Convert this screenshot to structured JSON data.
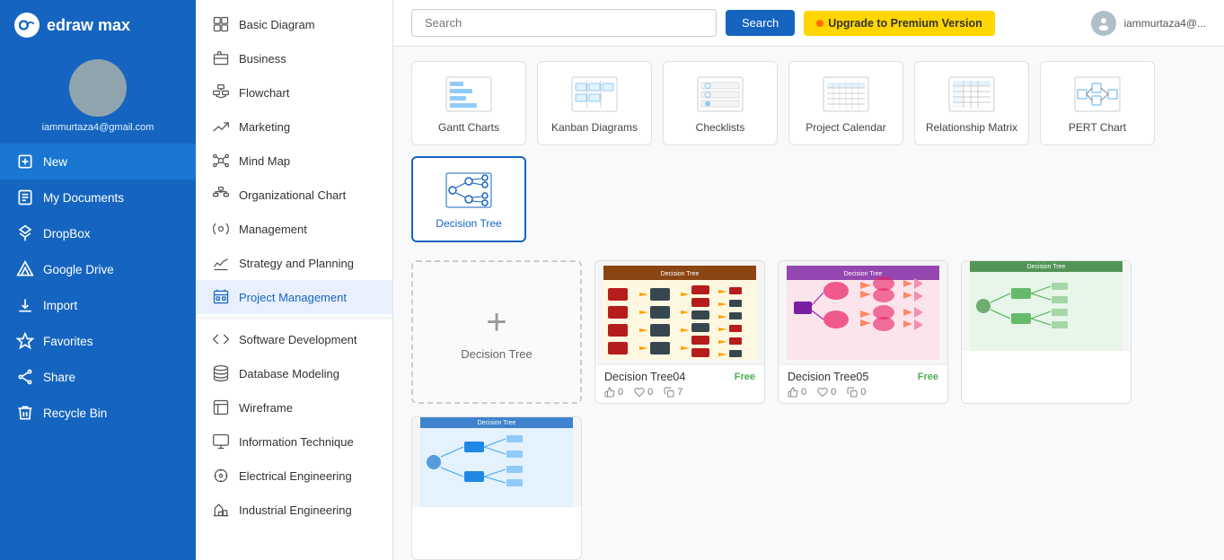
{
  "app": {
    "name": "edraw max",
    "logo_symbol": "D"
  },
  "user": {
    "email": "iammurtaza4@gmail.com",
    "email_short": "iammurtaza4@..."
  },
  "topbar": {
    "search_placeholder": "Search",
    "search_btn": "Search",
    "upgrade_btn": "Upgrade to Premium Version",
    "upgrade_dot_color": "#ff6d00"
  },
  "left_nav": [
    {
      "id": "new",
      "label": "New",
      "active": true
    },
    {
      "id": "my-documents",
      "label": "My Documents",
      "active": false
    },
    {
      "id": "dropbox",
      "label": "DropBox",
      "active": false
    },
    {
      "id": "google-drive",
      "label": "Google Drive",
      "active": false
    },
    {
      "id": "import",
      "label": "Import",
      "active": false
    },
    {
      "id": "favorites",
      "label": "Favorites",
      "active": false
    },
    {
      "id": "share",
      "label": "Share",
      "active": false
    },
    {
      "id": "recycle-bin",
      "label": "Recycle Bin",
      "active": false
    }
  ],
  "mid_nav": [
    {
      "id": "basic-diagram",
      "label": "Basic Diagram",
      "active": false
    },
    {
      "id": "business",
      "label": "Business",
      "active": false
    },
    {
      "id": "flowchart",
      "label": "Flowchart",
      "active": false
    },
    {
      "id": "marketing",
      "label": "Marketing",
      "active": false
    },
    {
      "id": "mind-map",
      "label": "Mind Map",
      "active": false
    },
    {
      "id": "organizational-chart",
      "label": "Organizational Chart",
      "active": false
    },
    {
      "id": "management",
      "label": "Management",
      "active": false
    },
    {
      "id": "strategy-and-planning",
      "label": "Strategy and Planning",
      "active": false
    },
    {
      "id": "project-management",
      "label": "Project Management",
      "active": true
    },
    {
      "id": "software-development",
      "label": "Software Development",
      "active": false
    },
    {
      "id": "database-modeling",
      "label": "Database Modeling",
      "active": false
    },
    {
      "id": "wireframe",
      "label": "Wireframe",
      "active": false
    },
    {
      "id": "information-technique",
      "label": "Information Technique",
      "active": false
    },
    {
      "id": "electrical-engineering",
      "label": "Electrical Engineering",
      "active": false
    },
    {
      "id": "industrial-engineering",
      "label": "Industrial Engineering",
      "active": false
    }
  ],
  "categories": [
    {
      "id": "gantt",
      "label": "Gantt Charts"
    },
    {
      "id": "kanban",
      "label": "Kanban Diagrams"
    },
    {
      "id": "checklists",
      "label": "Checklists"
    },
    {
      "id": "project-calendar",
      "label": "Project Calendar"
    },
    {
      "id": "relationship-matrix",
      "label": "Relationship Matrix"
    },
    {
      "id": "pert-chart",
      "label": "PERT Chart"
    },
    {
      "id": "decision-tree",
      "label": "Decision Tree",
      "selected": true
    }
  ],
  "templates": [
    {
      "id": "new-blank",
      "type": "new",
      "label": "Decision Tree"
    },
    {
      "id": "dt04",
      "label": "Decision Tree04",
      "badge": "Free",
      "likes": "0",
      "hearts": "0",
      "copies": "7"
    },
    {
      "id": "dt05",
      "label": "Decision Tree05",
      "badge": "Free",
      "likes": "0",
      "hearts": "0",
      "copies": "0"
    },
    {
      "id": "dt06",
      "label": "Decision Tree",
      "badge": "",
      "likes": "",
      "hearts": "",
      "copies": ""
    },
    {
      "id": "dt07",
      "label": "Decision Tree",
      "badge": "",
      "likes": "",
      "hearts": "",
      "copies": ""
    }
  ]
}
